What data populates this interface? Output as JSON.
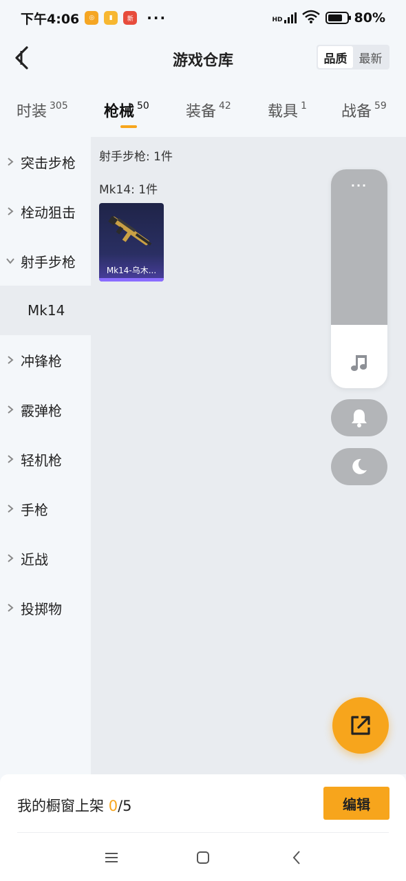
{
  "status_bar": {
    "time": "下午4:06",
    "network_label": "HD",
    "battery_level": 0.8,
    "battery_text": "80%",
    "notification_icons": [
      "soul-app-icon",
      "chat-app-icon",
      "news-app-icon"
    ],
    "more": "···"
  },
  "header": {
    "title": "游戏仓库",
    "sort_options": [
      {
        "label": "品质",
        "active": true
      },
      {
        "label": "最新",
        "active": false
      }
    ]
  },
  "tabs": [
    {
      "label": "时装",
      "count": "305",
      "active": false
    },
    {
      "label": "枪械",
      "count": "50",
      "active": true
    },
    {
      "label": "装备",
      "count": "42",
      "active": false
    },
    {
      "label": "载具",
      "count": "1",
      "active": false
    },
    {
      "label": "战备",
      "count": "59",
      "active": false
    }
  ],
  "sidebar": {
    "items": [
      {
        "label": "突击步枪",
        "expanded": false
      },
      {
        "label": "栓动狙击",
        "expanded": false
      },
      {
        "label": "射手步枪",
        "expanded": true
      },
      {
        "label": "Mk14",
        "sub": true,
        "selected": true
      },
      {
        "label": "冲锋枪",
        "expanded": false
      },
      {
        "label": "霰弹枪",
        "expanded": false
      },
      {
        "label": "轻机枪",
        "expanded": false
      },
      {
        "label": "手枪",
        "expanded": false
      },
      {
        "label": "近战",
        "expanded": false
      },
      {
        "label": "投掷物",
        "expanded": false
      }
    ]
  },
  "content": {
    "category_summary": "射手步枪: 1件",
    "group_summary": "Mk14: 1件",
    "items": [
      {
        "name": "Mk14-乌木..."
      }
    ]
  },
  "float_panel": {
    "more": "···",
    "buttons": [
      "music-icon",
      "bell-icon",
      "moon-icon"
    ]
  },
  "bottom_bar": {
    "shelf_label": "我的橱窗上架",
    "shelf_count": "0",
    "shelf_total": "/5",
    "edit_label": "编辑"
  },
  "colors": {
    "accent": "#f7a51c",
    "page_bg": "#f4f7fa",
    "content_bg": "#e9ecf0",
    "overlay_gray": "#b3b5b8"
  }
}
